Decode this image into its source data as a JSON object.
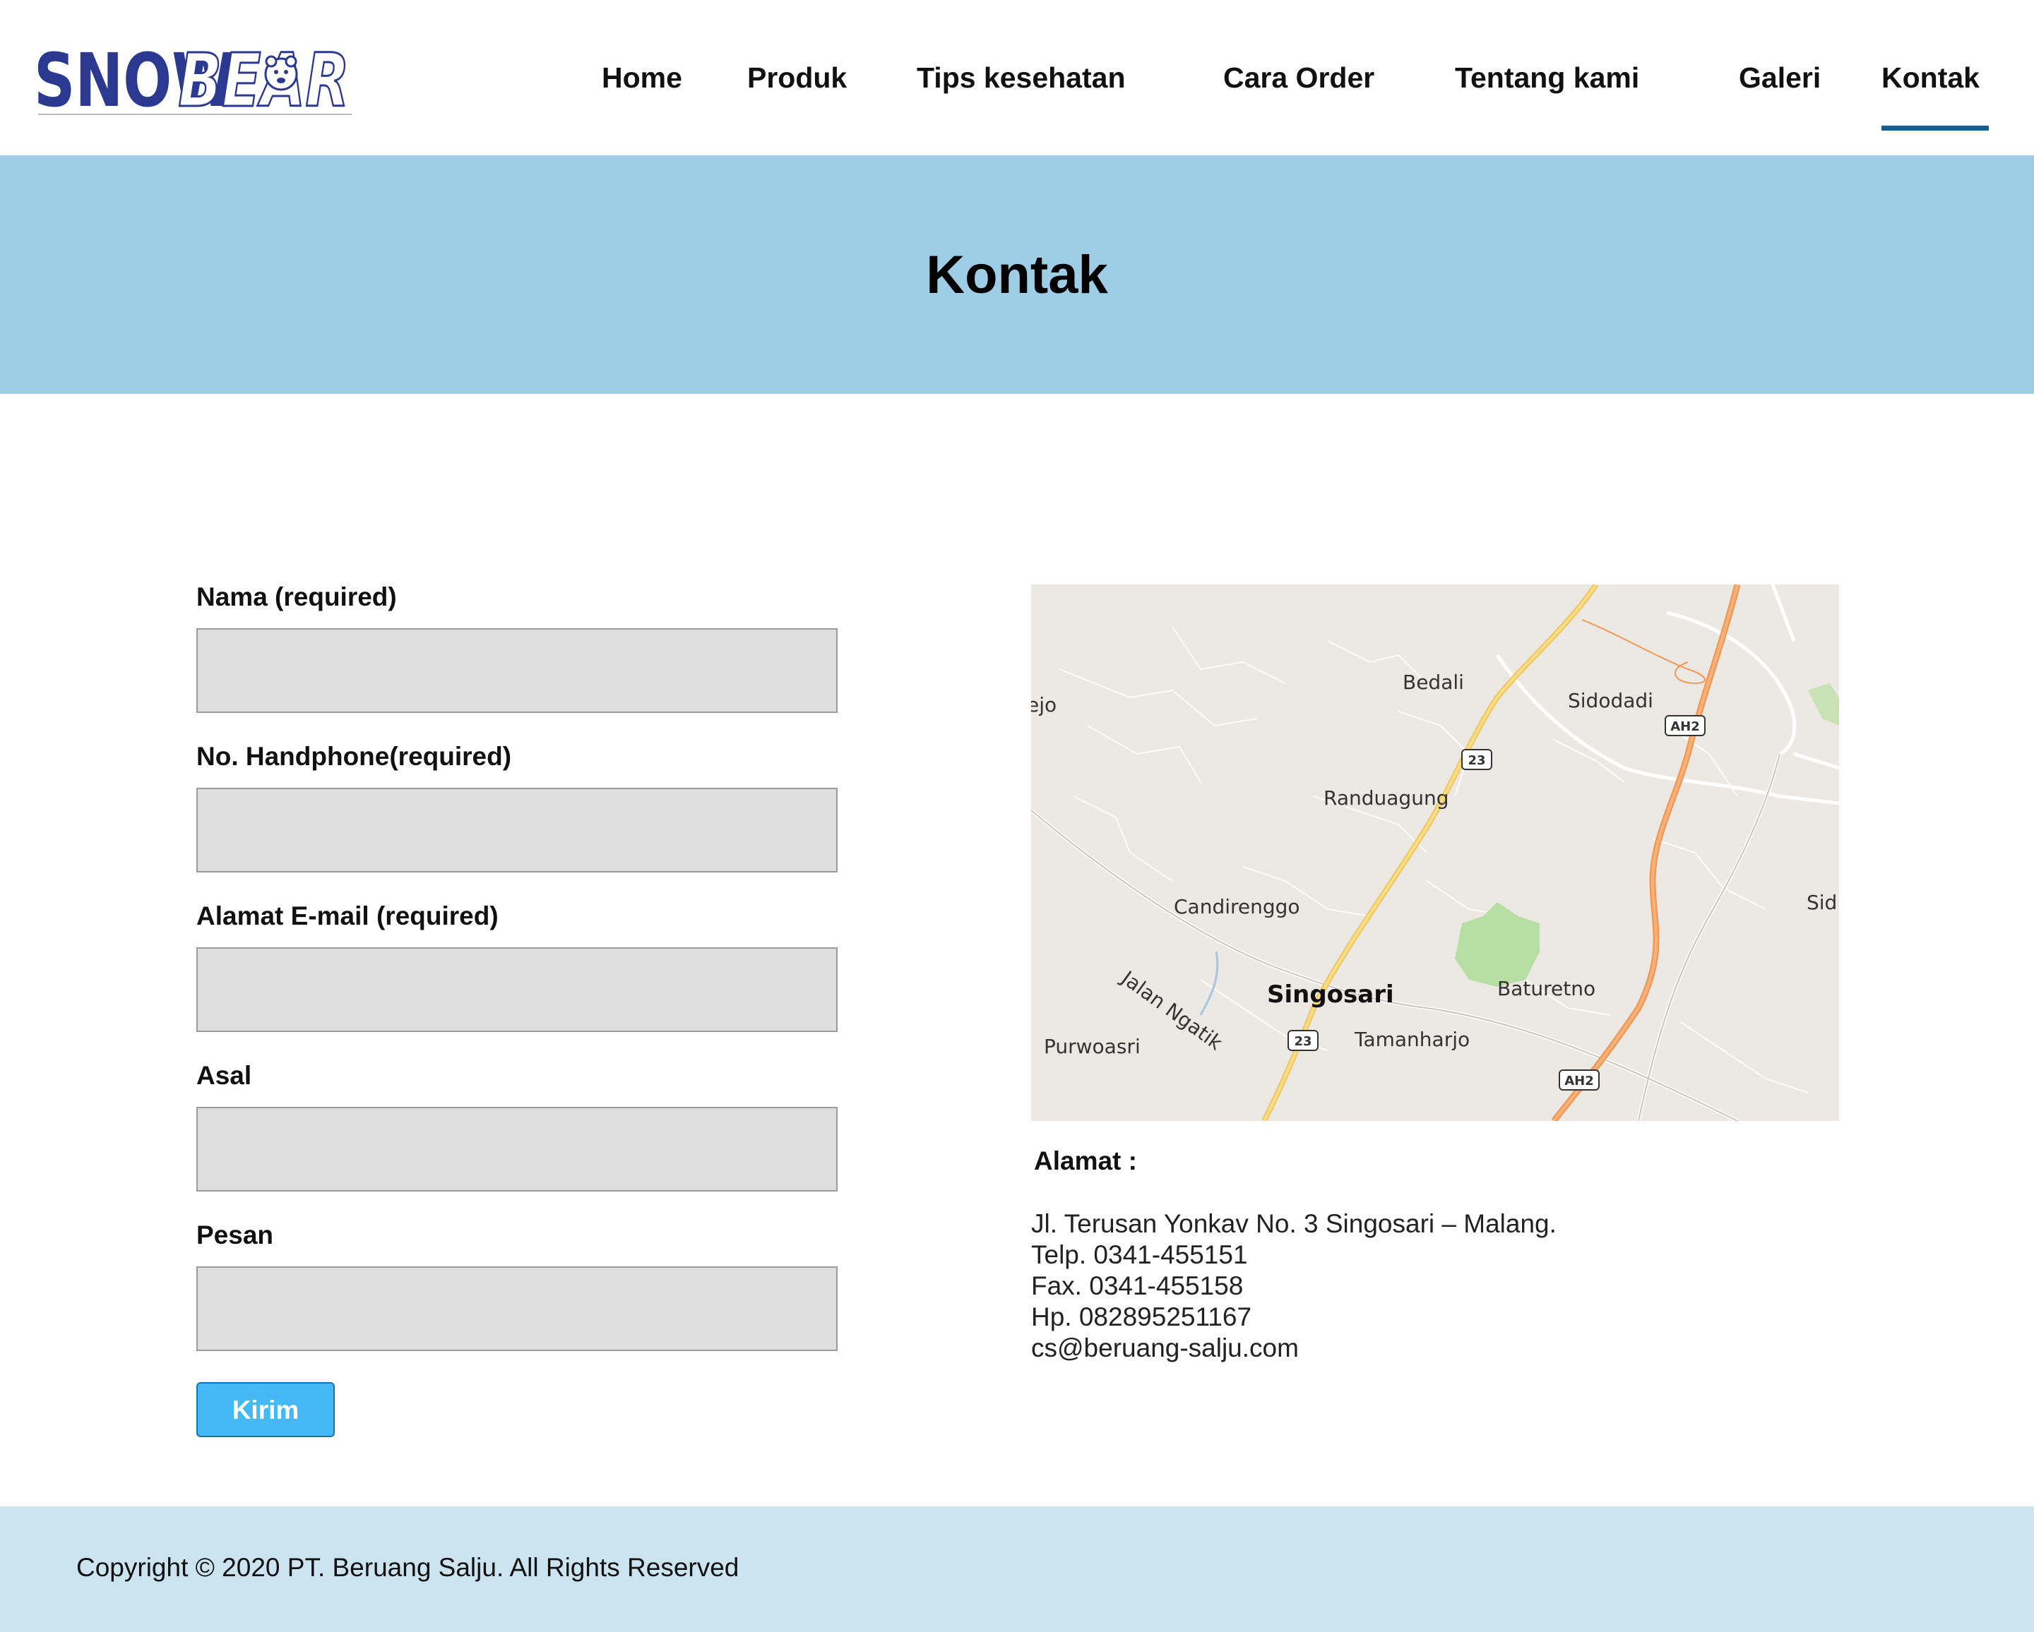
{
  "brand": {
    "logo_text_1": "SNOW",
    "logo_text_2": "BEAR",
    "logo_icon": "bear-head-icon"
  },
  "nav": {
    "items": [
      {
        "label": "Home"
      },
      {
        "label": "Produk"
      },
      {
        "label": "Tips kesehatan"
      },
      {
        "label": "Cara Order"
      },
      {
        "label": "Tentang kami"
      },
      {
        "label": "Galeri"
      },
      {
        "label": "Kontak"
      }
    ],
    "active": "Kontak"
  },
  "banner": {
    "title": "Kontak"
  },
  "form": {
    "fields": [
      {
        "label": "Nama (required)",
        "value": ""
      },
      {
        "label": "No. Handphone(required)",
        "value": ""
      },
      {
        "label": "Alamat E-mail (required)",
        "value": ""
      },
      {
        "label": "Asal",
        "value": ""
      },
      {
        "label": "Pesan",
        "value": ""
      }
    ],
    "submit_label": "Kirim"
  },
  "map": {
    "places": [
      "Bedali",
      "Sidodadi",
      "Randuagung",
      "Candirenggo",
      "Singosari",
      "Baturetno",
      "Tamanharjo",
      "Purwoasri",
      "Jalan Ngatik",
      "ejo",
      "Sid"
    ],
    "road_shields": [
      "23",
      "AH2",
      "23",
      "AH2"
    ]
  },
  "address": {
    "heading": "Alamat :",
    "lines": [
      "Jl. Terusan Yonkav No. 3 Singosari – Malang.",
      "Telp. 0341-455151",
      "Fax. 0341-455158",
      "Hp. 082895251167",
      "cs@beruang-salju.com"
    ]
  },
  "footer": {
    "copyright": "Copyright © 2020 PT. Beruang Salju. All Rights Reserved"
  },
  "colors": {
    "banner": "#9ecde6",
    "footer": "#cce3f0",
    "input_bg": "#dedede",
    "button": "#45b9f5",
    "nav_active_underline": "#1d5b94",
    "logo_blue": "#2b3990"
  }
}
